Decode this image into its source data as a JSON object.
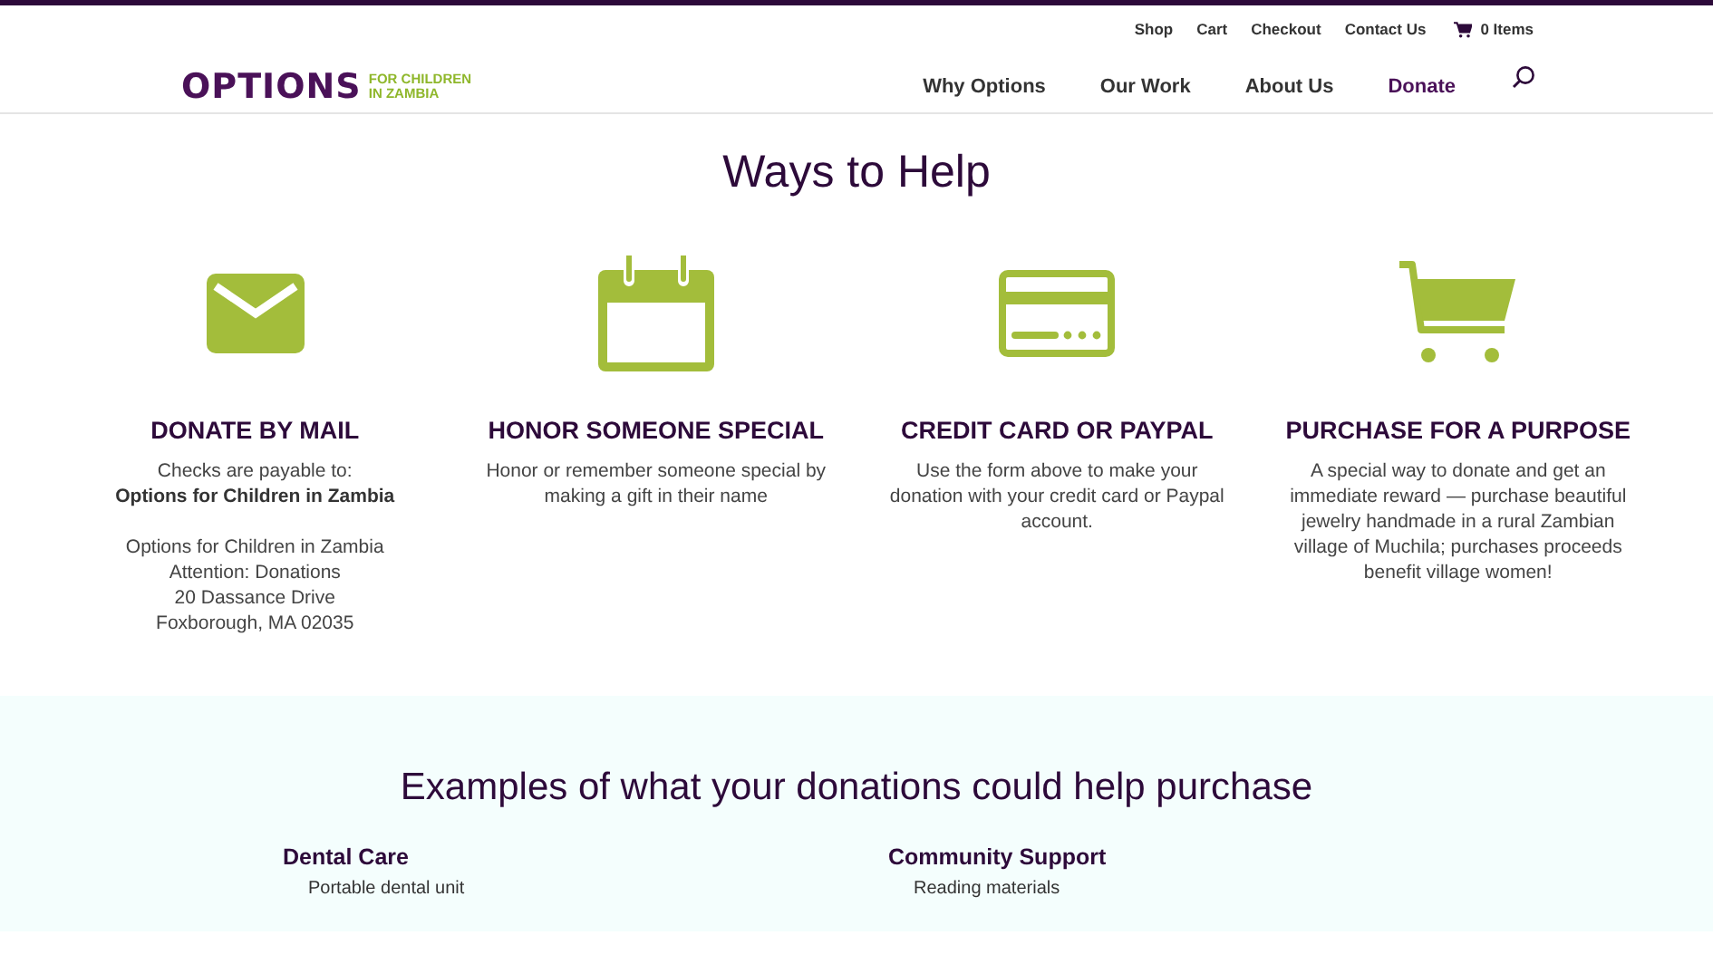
{
  "top_links": [
    "Shop",
    "Cart",
    "Checkout",
    "Contact Us"
  ],
  "cart": {
    "label": "0 Items"
  },
  "logo": {
    "name": "OPTIONS",
    "tagline": [
      "FOR CHILDREN",
      "IN ZAMBIA"
    ]
  },
  "nav": [
    {
      "label": "Why Options",
      "selected": false
    },
    {
      "label": "Our Work",
      "selected": false
    },
    {
      "label": "About Us",
      "selected": false
    },
    {
      "label": "Donate",
      "selected": true
    }
  ],
  "heading": "Ways to Help",
  "ways": [
    {
      "kind": "mail",
      "title": "DONATE BY MAIL",
      "paragraphs": [
        [
          "Checks are payable to:",
          "**Options for Children in Zambia**"
        ],
        [
          "Options for Children in Zambia",
          "Attention: Donations",
          "20 Dassance Drive",
          "Foxborough, MA 02035"
        ]
      ]
    },
    {
      "kind": "calendar",
      "title": "HONOR SOMEONE SPECIAL",
      "paragraphs": [
        [
          "Honor or remember someone special by making a gift in their name"
        ]
      ]
    },
    {
      "kind": "card",
      "title": "CREDIT CARD OR PAYPAL",
      "paragraphs": [
        [
          "Use the form above to make your donation with your credit card or Paypal account."
        ]
      ]
    },
    {
      "kind": "cart",
      "title": "PURCHASE FOR A PURPOSE",
      "paragraphs": [
        [
          "A special way to donate and get an immediate reward — purchase beautiful jewelry handmade in a rural Zambian village of Muchila; purchases proceeds benefit village women!"
        ]
      ]
    }
  ],
  "examples": {
    "heading": "Examples of what your donations could help purchase",
    "columns": [
      {
        "title": "Dental Care",
        "items": [
          "Portable dental unit"
        ]
      },
      {
        "title": "Community Support",
        "items": [
          "Reading materials"
        ]
      }
    ]
  }
}
